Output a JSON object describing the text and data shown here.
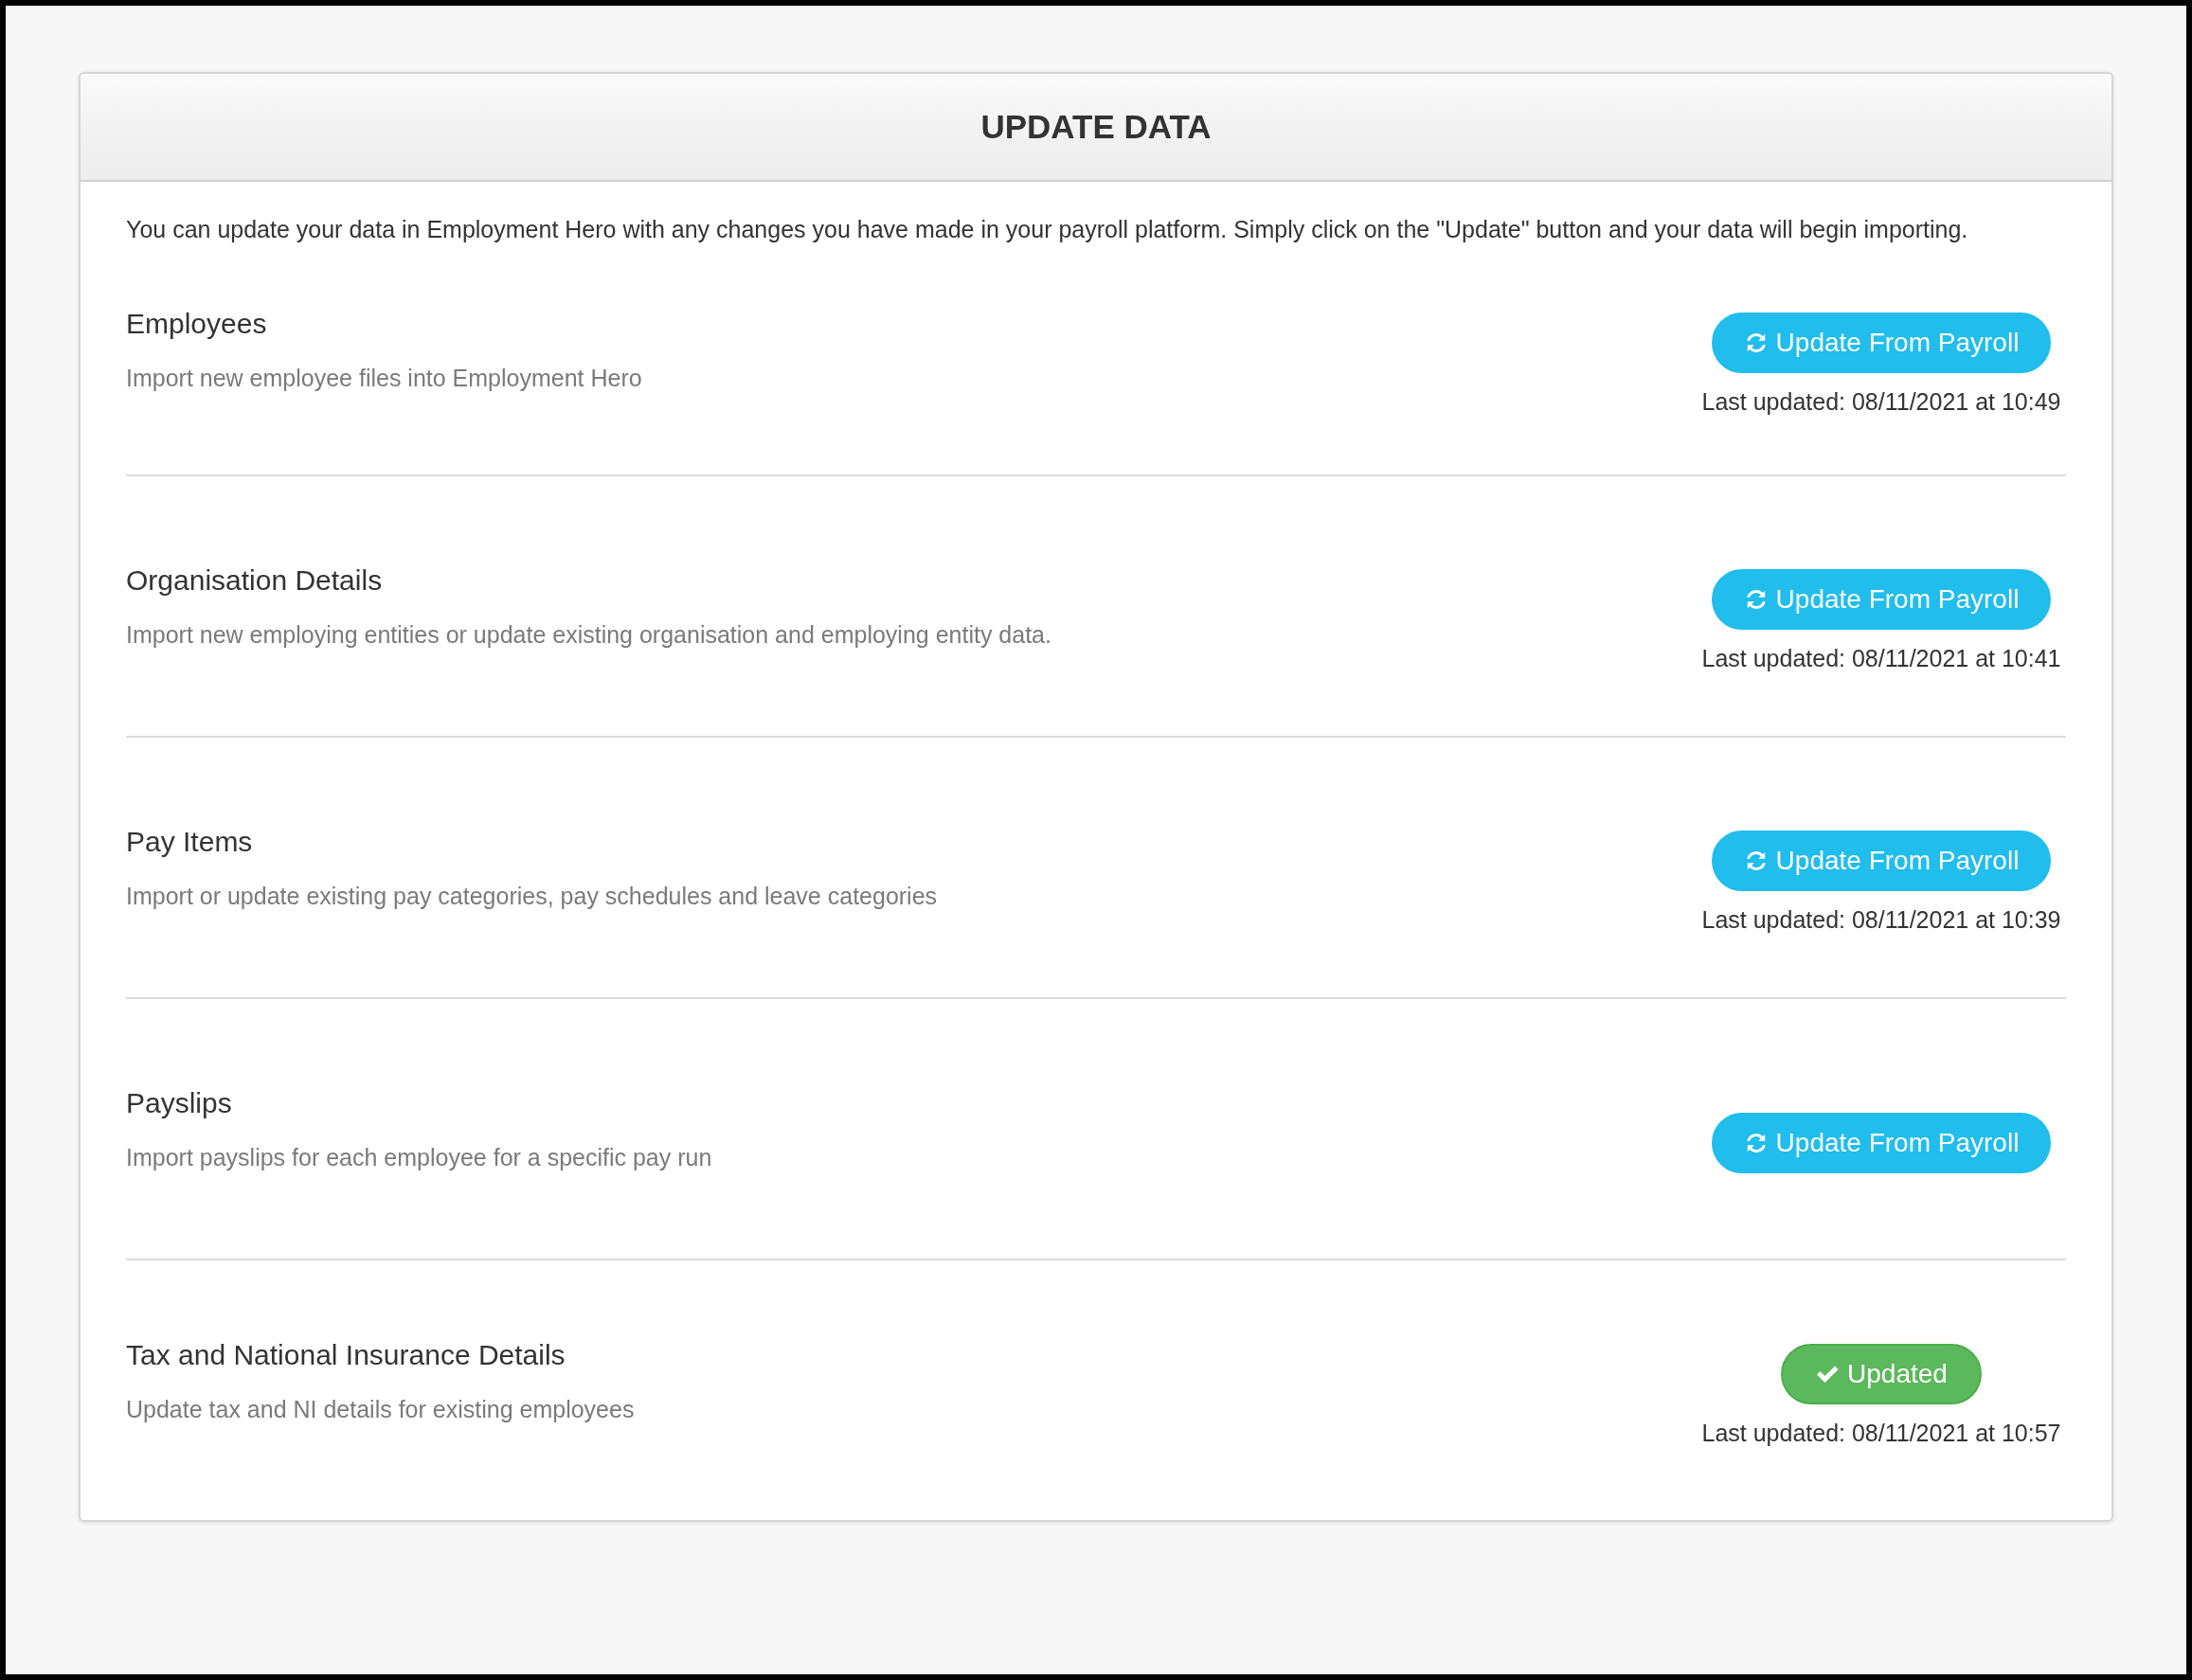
{
  "panel": {
    "title": "UPDATE DATA",
    "intro": "You can update your data in Employment Hero with any changes you have made in your payroll platform. Simply click on the \"Update\" button and your data will begin importing."
  },
  "sections": [
    {
      "title": "Employees",
      "description": "Import new employee files into Employment Hero",
      "button": {
        "kind": "update",
        "label": "Update From Payroll"
      },
      "last_updated": "Last updated: 08/11/2021 at 10:49"
    },
    {
      "title": "Organisation Details",
      "description": "Import new employing entities or update existing organisation and employing entity data.",
      "button": {
        "kind": "update",
        "label": "Update From Payroll"
      },
      "last_updated": "Last updated: 08/11/2021 at 10:41"
    },
    {
      "title": "Pay Items",
      "description": "Import or update existing pay categories, pay schedules and leave categories",
      "button": {
        "kind": "update",
        "label": "Update From Payroll"
      },
      "last_updated": "Last updated: 08/11/2021 at 10:39"
    },
    {
      "title": "Payslips",
      "description": "Import payslips for each employee for a specific pay run",
      "button": {
        "kind": "update",
        "label": "Update From Payroll"
      }
    },
    {
      "title": "Tax and National Insurance Details",
      "description": "Update tax and NI details for existing employees",
      "button": {
        "kind": "updated",
        "label": "Updated"
      },
      "last_updated": "Last updated: 08/11/2021 at 10:57"
    }
  ]
}
